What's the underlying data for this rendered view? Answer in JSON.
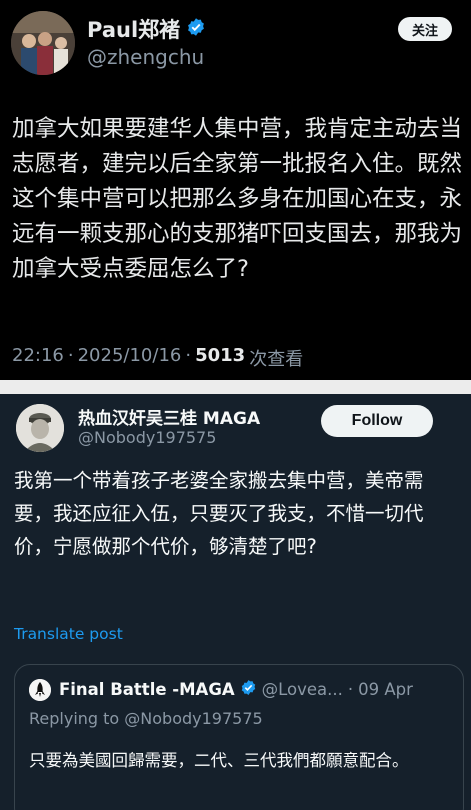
{
  "tweet1": {
    "name": "Paul郑褚",
    "handle": "@zhengchu",
    "follow_label": "关注",
    "text": "加拿大如果要建华人集中营，我肯定主动去当志愿者，建完以后全家第一批报名入住。既然这个集中营可以把那么多身在加国心在支，永远有一颗支那心的支那猪吓回支国去，那我为加拿大受点委屈怎么了?",
    "time": "22:16",
    "date": "2025/10/16",
    "separator": "·",
    "views_count": "5013",
    "views_label": "次查看",
    "verified_icon": "verified-badge-icon",
    "colors": {
      "background": "#000000",
      "badge": "#1d9bf0"
    }
  },
  "tweet2": {
    "name": "热血汉奸吴三桂 MAGA",
    "handle": "@Nobody197575",
    "follow_label": "Follow",
    "text": "我第一个带着孩子老婆全家搬去集中营，美帝需要，我还应征入伍，只要灭了我支，不惜一切代价，宁愿做那个代价，够清楚了吧?",
    "translate_label": "Translate post",
    "colors": {
      "background": "#15202b",
      "link": "#1d9bf0"
    },
    "quote": {
      "name": "Final Battle -MAGA",
      "handle": "@Lovea...",
      "separator": "·",
      "date": "09 Apr",
      "replying_to": "Replying to @Nobody197575",
      "text": "只要為美國回歸需要，二代、三代我們都願意配合。",
      "verified_icon": "verified-badge-icon",
      "colors": {
        "badge": "#1d9bf0"
      }
    }
  }
}
